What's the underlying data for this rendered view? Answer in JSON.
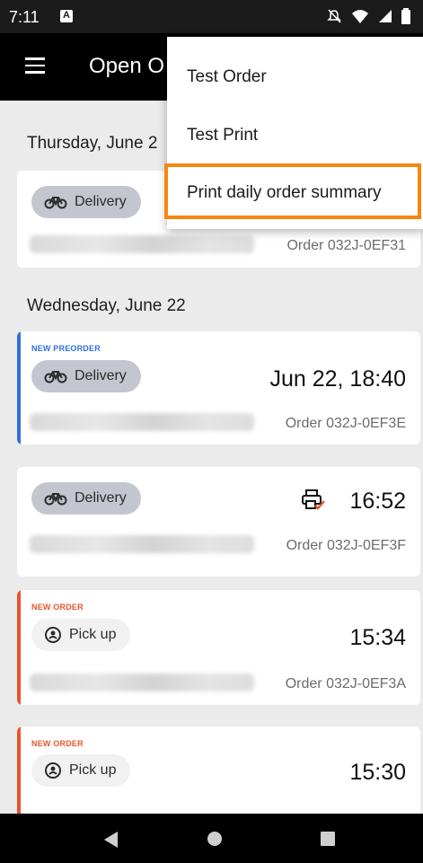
{
  "status_bar": {
    "time": "7:11"
  },
  "app_bar": {
    "title": "Open O"
  },
  "menu": {
    "items": [
      {
        "label": "Test Order"
      },
      {
        "label": "Test Print"
      },
      {
        "label": "Print daily order summary"
      }
    ],
    "highlight_color": "#f7860f"
  },
  "sections": [
    {
      "date": "Thursday, June 2"
    },
    {
      "date": "Wednesday, June 22"
    }
  ],
  "orders": [
    {
      "type": "Delivery",
      "order": "Order 032J-0EF31",
      "time": "",
      "tag": ""
    },
    {
      "type": "Delivery",
      "order": "Order 032J-0EF3E",
      "time": "Jun 22, 18:40",
      "tag": "NEW PREORDER",
      "accent": "#2f6fe0"
    },
    {
      "type": "Delivery",
      "order": "Order 032J-0EF3F",
      "time": "16:52",
      "tag": "",
      "print_status_icon": "printer-check-icon"
    },
    {
      "type": "Pick up",
      "order": "Order 032J-0EF3A",
      "time": "15:34",
      "tag": "NEW ORDER",
      "accent": "#e8542a"
    },
    {
      "type": "Pick up",
      "order": "",
      "time": "15:30",
      "tag": "NEW ORDER",
      "accent": "#e8542a"
    }
  ],
  "colors": {
    "preorder": "#2f6fe0",
    "new_order": "#e8542a",
    "delivery_chip": "#c3c6cf"
  }
}
